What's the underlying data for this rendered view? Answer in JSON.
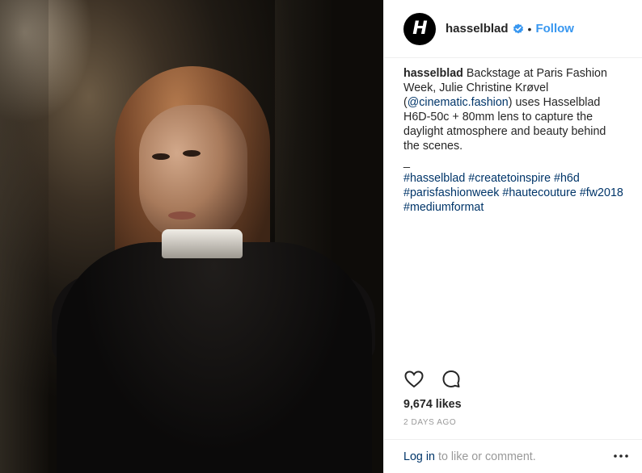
{
  "post": {
    "username": "hasselblad",
    "avatar_glyph": "H",
    "follow_label": "Follow",
    "separator": "•",
    "caption": {
      "user": "hasselblad",
      "text_before_link": " Backstage at Paris Fashion Week, Julie Christine Krøvel (",
      "link": "@cinematic.fashion",
      "text_after_link": ") uses Hasselblad H6D-50c + 80mm lens to capture the daylight atmosphere and beauty behind the scenes.",
      "dash": "_",
      "hashtags": [
        "#hasselblad",
        "#createtoinspire",
        "#h6d",
        "#parisfashionweek",
        "#hautecouture",
        "#fw2018",
        "#mediumformat"
      ]
    },
    "likes": "9,674 likes",
    "time": "2 DAYS AGO",
    "footer": {
      "login_label": "Log in",
      "rest_text": "to like or comment."
    }
  },
  "icons": [
    "verified-badge-icon",
    "heart-icon",
    "comment-icon",
    "more-options-icon"
  ],
  "colors": {
    "accent": "#3897f0",
    "link": "#003569",
    "muted": "#999999",
    "text": "#262626"
  }
}
